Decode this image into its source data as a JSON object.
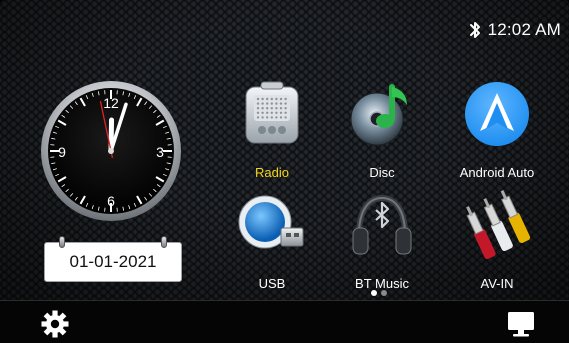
{
  "status_bar": {
    "bluetooth_icon": "bluetooth-icon",
    "time": "12:02 AM"
  },
  "clock": {
    "numerals": [
      "12",
      "3",
      "6",
      "9"
    ],
    "hour": 12,
    "minute": 2,
    "second": 58,
    "date": "01-01-2021"
  },
  "apps": [
    {
      "label": "Radio",
      "icon": "radio-icon",
      "active": true
    },
    {
      "label": "Disc",
      "icon": "disc-icon",
      "active": false
    },
    {
      "label": "Android Auto",
      "icon": "android-auto-icon",
      "active": false
    },
    {
      "label": "USB",
      "icon": "usb-icon",
      "active": false
    },
    {
      "label": "BT Music",
      "icon": "bt-music-icon",
      "active": false
    },
    {
      "label": "AV-IN",
      "icon": "av-in-icon",
      "active": false
    }
  ],
  "pager": {
    "pages": 2,
    "current": 1
  },
  "bottom_bar": {
    "left_icon": "settings-icon",
    "right_icon": "display-icon"
  },
  "colors": {
    "active_label": "#f2d51c",
    "android_auto_blue": "#1e8ef0"
  }
}
